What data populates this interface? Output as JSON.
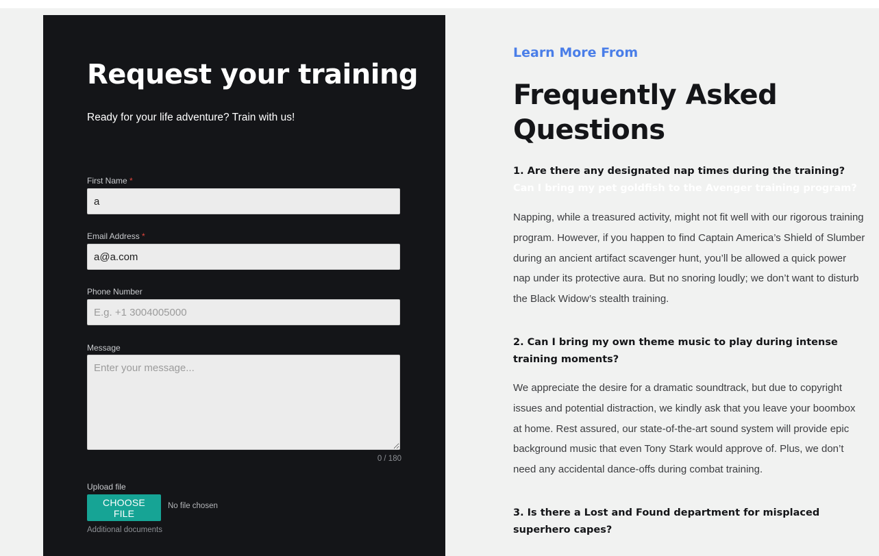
{
  "form": {
    "title": "Request your training",
    "subtitle": "Ready for your life adventure? Train with us!",
    "required_mark": "*",
    "first_name": {
      "label": "First Name",
      "value": "a"
    },
    "email": {
      "label": "Email Address",
      "value": "a@a.com"
    },
    "phone": {
      "label": "Phone Number",
      "placeholder": "E.g. +1 3004005000"
    },
    "message": {
      "label": "Message",
      "placeholder": "Enter your message...",
      "counter": "0 / 180"
    },
    "upload": {
      "label": "Upload file",
      "button_label": "CHOOSE FILE",
      "status": "No file chosen",
      "helper": "Additional documents"
    }
  },
  "faq": {
    "eyebrow": "Learn More From",
    "title": "Frequently Asked Questions",
    "items": [
      {
        "question": "1. Are there any designated nap times during the training?",
        "question_hidden": " Can I bring my pet goldfish to the Avenger training program?",
        "answer": "Napping, while a treasured activity, might not fit well with our rigorous training program. However, if you happen to find Captain America’s Shield of Slumber during an ancient artifact scavenger hunt, you’ll be allowed a quick power nap under its protective aura. But no snoring loudly; we don’t want to disturb the Black Widow’s stealth training."
      },
      {
        "question": "2. Can I bring my own theme music to play during intense training moments?",
        "answer": "We appreciate the desire for a dramatic soundtrack, but due to copyright issues and potential distraction, we kindly ask that you leave your boombox at home. Rest assured, our state-of-the-art sound system will provide epic background music that even Tony Stark would approve of. Plus, we don’t need any accidental dance-offs during combat training."
      },
      {
        "question": "3. Is there a Lost and Found department for misplaced superhero capes?"
      }
    ]
  },
  "colors": {
    "panel": "#141518",
    "accent_blue": "#4a7ee8",
    "button_teal": "#16a495",
    "required_red": "#e2453c",
    "page_bg": "#f1f2f1"
  }
}
